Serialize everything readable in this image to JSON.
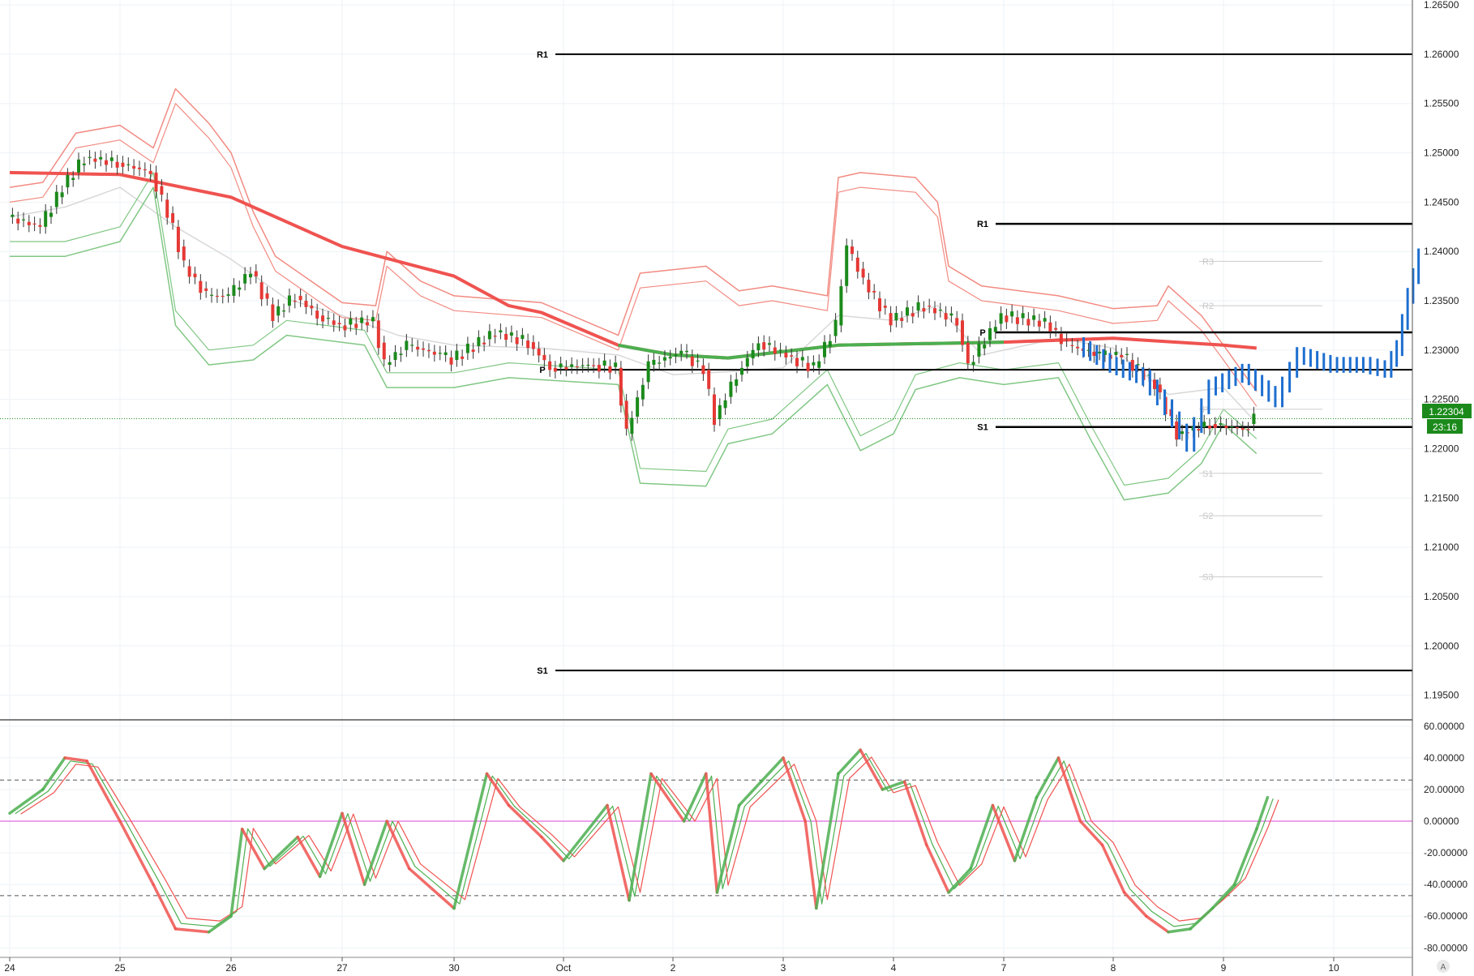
{
  "colors": {
    "bull": "#1b8a1b",
    "bear": "#e53935",
    "forecast": "#1e6fd0",
    "ema_red": "#ef5350",
    "ema_green": "#4caf50",
    "band_red": "#f28b82",
    "band_green": "#81c784",
    "mid_grey": "#d8d8d8",
    "level_line": "#000000",
    "faint_level": "#cccccc",
    "price_tag": "#1b8a1b",
    "osc_fast": "#ef5350",
    "osc_slow": "#4caf50",
    "osc_zero": "#d946d9",
    "grid": "#eef2f6"
  },
  "price_axis": {
    "labels": [
      "1.26500",
      "1.26000",
      "1.25500",
      "1.25000",
      "1.24500",
      "1.24000",
      "1.23500",
      "1.23000",
      "1.22500",
      "1.22000",
      "1.21500",
      "1.21000",
      "1.20500",
      "1.20000",
      "1.19500"
    ],
    "current_price": "1.22304",
    "countdown": "23:16"
  },
  "osc_axis": {
    "labels": [
      "60.00000",
      "40.00000",
      "20.00000",
      "0.00000",
      "-20.00000",
      "-40.00000",
      "-60.00000",
      "-80.00000"
    ]
  },
  "time_axis": {
    "labels": [
      "24",
      "25",
      "26",
      "27",
      "30",
      "Oct",
      "2",
      "3",
      "4",
      "7",
      "8",
      "9",
      "10"
    ],
    "corner": "A"
  },
  "chart_data": {
    "type": "line",
    "title": "",
    "xlabel": "",
    "ylabel": "",
    "ylim": [
      1.1925,
      1.2655
    ],
    "grid": true,
    "pivots": [
      {
        "label": "R1",
        "value": 1.26,
        "x_from": "Oct",
        "x_to": "right-edge"
      },
      {
        "label": "S1",
        "value": 1.1975,
        "x_from": "Oct",
        "x_to": "right-edge"
      },
      {
        "label": "P",
        "value": 1.228,
        "x_from": "Oct",
        "x_to": "right-edge"
      },
      {
        "label": "R1",
        "value": 1.2428,
        "x_from": "7",
        "x_to": "right-edge"
      },
      {
        "label": "P",
        "value": 1.2318,
        "x_from": "7",
        "x_to": "right-edge"
      },
      {
        "label": "S1",
        "value": 1.2222,
        "x_from": "7",
        "x_to": "right-edge"
      }
    ],
    "faint_pivots": [
      {
        "label": "R3",
        "value": 1.239
      },
      {
        "label": "R2",
        "value": 1.2345
      },
      {
        "label": "P",
        "value": 1.224
      },
      {
        "label": "S1",
        "value": 1.2175
      },
      {
        "label": "S2",
        "value": 1.2132
      },
      {
        "label": "S3",
        "value": 1.207
      }
    ],
    "ema_long": [
      {
        "d": 24.0,
        "y": 1.248
      },
      {
        "d": 25.0,
        "y": 1.2478
      },
      {
        "d": 26.0,
        "y": 1.2455
      },
      {
        "d": 27.0,
        "y": 1.2405
      },
      {
        "d": 27.5,
        "y": 1.239
      },
      {
        "d": 30.0,
        "y": 1.2375
      },
      {
        "d": 30.5,
        "y": 1.2345
      },
      {
        "d": 30.8,
        "y": 1.2338
      },
      {
        "d": 31.5,
        "y": 1.2305
      },
      {
        "d": 32.0,
        "y": 1.2295
      },
      {
        "d": 32.5,
        "y": 1.2292
      },
      {
        "d": 33.5,
        "y": 1.2305
      },
      {
        "d": 35.0,
        "y": 1.2308
      },
      {
        "d": 36.0,
        "y": 1.2312
      },
      {
        "d": 37.0,
        "y": 1.2305
      },
      {
        "d": 37.3,
        "y": 1.2302
      }
    ],
    "ema_long_green_ranges": [
      [
        31.5,
        33.5
      ],
      [
        33.5,
        35.7
      ]
    ],
    "band_upper": [
      {
        "d": 24.0,
        "y": 1.2465
      },
      {
        "d": 24.3,
        "y": 1.247
      },
      {
        "d": 24.6,
        "y": 1.252
      },
      {
        "d": 25.0,
        "y": 1.2528
      },
      {
        "d": 25.3,
        "y": 1.2505
      },
      {
        "d": 25.5,
        "y": 1.2565
      },
      {
        "d": 25.8,
        "y": 1.253
      },
      {
        "d": 26.0,
        "y": 1.25
      },
      {
        "d": 26.2,
        "y": 1.244
      },
      {
        "d": 26.4,
        "y": 1.2395
      },
      {
        "d": 27.0,
        "y": 1.2348
      },
      {
        "d": 27.3,
        "y": 1.2345
      },
      {
        "d": 27.4,
        "y": 1.24
      },
      {
        "d": 27.7,
        "y": 1.237
      },
      {
        "d": 30.0,
        "y": 1.2355
      },
      {
        "d": 30.8,
        "y": 1.2348
      },
      {
        "d": 31.5,
        "y": 1.2315
      },
      {
        "d": 31.7,
        "y": 1.2378
      },
      {
        "d": 32.3,
        "y": 1.2385
      },
      {
        "d": 32.6,
        "y": 1.236
      },
      {
        "d": 32.9,
        "y": 1.2365
      },
      {
        "d": 33.4,
        "y": 1.2355
      },
      {
        "d": 33.5,
        "y": 1.2475
      },
      {
        "d": 33.7,
        "y": 1.248
      },
      {
        "d": 34.2,
        "y": 1.2475
      },
      {
        "d": 34.4,
        "y": 1.245
      },
      {
        "d": 34.5,
        "y": 1.2385
      },
      {
        "d": 34.8,
        "y": 1.2365
      },
      {
        "d": 35.5,
        "y": 1.2355
      },
      {
        "d": 36.0,
        "y": 1.2342
      },
      {
        "d": 36.4,
        "y": 1.2345
      },
      {
        "d": 36.5,
        "y": 1.2365
      },
      {
        "d": 36.8,
        "y": 1.2335
      },
      {
        "d": 37.0,
        "y": 1.2305
      },
      {
        "d": 37.3,
        "y": 1.2258
      }
    ],
    "band_lower": [
      {
        "d": 24.0,
        "y": 1.2395
      },
      {
        "d": 24.5,
        "y": 1.2395
      },
      {
        "d": 25.0,
        "y": 1.241
      },
      {
        "d": 25.3,
        "y": 1.2465
      },
      {
        "d": 25.5,
        "y": 1.2325
      },
      {
        "d": 25.8,
        "y": 1.2285
      },
      {
        "d": 26.2,
        "y": 1.229
      },
      {
        "d": 26.5,
        "y": 1.2315
      },
      {
        "d": 27.2,
        "y": 1.2305
      },
      {
        "d": 27.4,
        "y": 1.2262
      },
      {
        "d": 30.0,
        "y": 1.2262
      },
      {
        "d": 30.5,
        "y": 1.2272
      },
      {
        "d": 31.5,
        "y": 1.2265
      },
      {
        "d": 31.7,
        "y": 1.2165
      },
      {
        "d": 32.3,
        "y": 1.2162
      },
      {
        "d": 32.5,
        "y": 1.2205
      },
      {
        "d": 32.9,
        "y": 1.2215
      },
      {
        "d": 33.4,
        "y": 1.2265
      },
      {
        "d": 33.7,
        "y": 1.2198
      },
      {
        "d": 34.0,
        "y": 1.2215
      },
      {
        "d": 34.2,
        "y": 1.226
      },
      {
        "d": 34.6,
        "y": 1.2272
      },
      {
        "d": 35.0,
        "y": 1.2265
      },
      {
        "d": 35.5,
        "y": 1.2272
      },
      {
        "d": 35.8,
        "y": 1.2208
      },
      {
        "d": 36.1,
        "y": 1.2148
      },
      {
        "d": 36.5,
        "y": 1.2155
      },
      {
        "d": 36.8,
        "y": 1.2185
      },
      {
        "d": 37.0,
        "y": 1.2225
      },
      {
        "d": 37.3,
        "y": 1.2195
      }
    ],
    "band_mid": [
      {
        "d": 24.0,
        "y": 1.2435
      },
      {
        "d": 24.5,
        "y": 1.2445
      },
      {
        "d": 25.0,
        "y": 1.2465
      },
      {
        "d": 25.5,
        "y": 1.2425
      },
      {
        "d": 26.0,
        "y": 1.2392
      },
      {
        "d": 26.5,
        "y": 1.2352
      },
      {
        "d": 27.0,
        "y": 1.2335
      },
      {
        "d": 27.5,
        "y": 1.2315
      },
      {
        "d": 30.0,
        "y": 1.2305
      },
      {
        "d": 30.8,
        "y": 1.2302
      },
      {
        "d": 31.5,
        "y": 1.2295
      },
      {
        "d": 32.0,
        "y": 1.2275
      },
      {
        "d": 32.5,
        "y": 1.2278
      },
      {
        "d": 33.0,
        "y": 1.2282
      },
      {
        "d": 33.5,
        "y": 1.2335
      },
      {
        "d": 34.0,
        "y": 1.233
      },
      {
        "d": 34.4,
        "y": 1.2345
      },
      {
        "d": 34.8,
        "y": 1.2295
      },
      {
        "d": 35.5,
        "y": 1.2312
      },
      {
        "d": 36.0,
        "y": 1.2302
      },
      {
        "d": 36.5,
        "y": 1.2255
      },
      {
        "d": 37.0,
        "y": 1.2262
      },
      {
        "d": 37.3,
        "y": 1.2226
      }
    ],
    "forecast": [
      {
        "d": 35.7,
        "y": 1.2305
      },
      {
        "d": 36.0,
        "y": 1.2285
      },
      {
        "d": 36.3,
        "y": 1.2272
      },
      {
        "d": 36.5,
        "y": 1.2242
      },
      {
        "d": 36.7,
        "y": 1.2205
      },
      {
        "d": 36.9,
        "y": 1.2262
      },
      {
        "d": 37.2,
        "y": 1.2278
      },
      {
        "d": 37.5,
        "y": 1.225
      },
      {
        "d": 37.7,
        "y": 1.2295
      },
      {
        "d": 38.0,
        "y": 1.2285
      },
      {
        "d": 38.3,
        "y": 1.2285
      },
      {
        "d": 38.5,
        "y": 1.228
      },
      {
        "d": 38.6,
        "y": 1.2302
      },
      {
        "d": 38.7,
        "y": 1.2355
      },
      {
        "d": 38.8,
        "y": 1.2395
      }
    ],
    "candles": [
      {
        "d": 24.0,
        "y": 1.2435
      },
      {
        "d": 24.3,
        "y": 1.2425
      },
      {
        "d": 24.5,
        "y": 1.2465
      },
      {
        "d": 24.7,
        "y": 1.2495
      },
      {
        "d": 25.0,
        "y": 1.249
      },
      {
        "d": 25.3,
        "y": 1.248
      },
      {
        "d": 25.5,
        "y": 1.2425
      },
      {
        "d": 25.6,
        "y": 1.2385
      },
      {
        "d": 25.8,
        "y": 1.2355
      },
      {
        "d": 26.0,
        "y": 1.2355
      },
      {
        "d": 26.2,
        "y": 1.238
      },
      {
        "d": 26.4,
        "y": 1.2335
      },
      {
        "d": 26.6,
        "y": 1.2355
      },
      {
        "d": 26.8,
        "y": 1.2335
      },
      {
        "d": 27.0,
        "y": 1.2325
      },
      {
        "d": 27.3,
        "y": 1.233
      },
      {
        "d": 27.4,
        "y": 1.2285
      },
      {
        "d": 27.6,
        "y": 1.2305
      },
      {
        "d": 27.9,
        "y": 1.2295
      },
      {
        "d": 30.0,
        "y": 1.229
      },
      {
        "d": 30.4,
        "y": 1.2318
      },
      {
        "d": 30.7,
        "y": 1.2308
      },
      {
        "d": 30.9,
        "y": 1.2282
      },
      {
        "d": 31.3,
        "y": 1.2285
      },
      {
        "d": 31.5,
        "y": 1.2282
      },
      {
        "d": 31.6,
        "y": 1.2215
      },
      {
        "d": 31.8,
        "y": 1.2285
      },
      {
        "d": 32.1,
        "y": 1.2298
      },
      {
        "d": 32.3,
        "y": 1.228
      },
      {
        "d": 32.4,
        "y": 1.223
      },
      {
        "d": 32.6,
        "y": 1.2275
      },
      {
        "d": 32.8,
        "y": 1.2308
      },
      {
        "d": 33.1,
        "y": 1.2292
      },
      {
        "d": 33.3,
        "y": 1.2282
      },
      {
        "d": 33.5,
        "y": 1.2325
      },
      {
        "d": 33.6,
        "y": 1.2405
      },
      {
        "d": 33.8,
        "y": 1.236
      },
      {
        "d": 34.0,
        "y": 1.233
      },
      {
        "d": 34.3,
        "y": 1.2345
      },
      {
        "d": 34.6,
        "y": 1.233
      },
      {
        "d": 34.7,
        "y": 1.2285
      },
      {
        "d": 35.0,
        "y": 1.2335
      },
      {
        "d": 35.4,
        "y": 1.2328
      },
      {
        "d": 35.6,
        "y": 1.2305
      },
      {
        "d": 35.9,
        "y": 1.2295
      },
      {
        "d": 36.1,
        "y": 1.2295
      },
      {
        "d": 36.4,
        "y": 1.2265
      },
      {
        "d": 36.6,
        "y": 1.2215
      },
      {
        "d": 36.9,
        "y": 1.2225
      },
      {
        "d": 37.2,
        "y": 1.222
      },
      {
        "d": 37.3,
        "y": 1.223
      }
    ],
    "oscillator": {
      "ylim": [
        -86,
        64
      ],
      "upper_level": 26,
      "lower_level": -47,
      "zero_level": 0,
      "series": [
        {
          "name": "",
          "values": [
            {
              "d": 24.0,
              "y": 5
            },
            {
              "d": 24.3,
              "y": 20
            },
            {
              "d": 24.5,
              "y": 40
            },
            {
              "d": 24.7,
              "y": 38
            },
            {
              "d": 25.0,
              "y": 0
            },
            {
              "d": 25.3,
              "y": -40
            },
            {
              "d": 25.5,
              "y": -68
            },
            {
              "d": 25.8,
              "y": -70
            },
            {
              "d": 26.0,
              "y": -60
            },
            {
              "d": 26.1,
              "y": -5
            },
            {
              "d": 26.3,
              "y": -30
            },
            {
              "d": 26.6,
              "y": -10
            },
            {
              "d": 26.8,
              "y": -35
            },
            {
              "d": 27.0,
              "y": 5
            },
            {
              "d": 27.2,
              "y": -40
            },
            {
              "d": 27.4,
              "y": 0
            },
            {
              "d": 27.6,
              "y": -30
            },
            {
              "d": 28.0,
              "y": -55
            },
            {
              "d": 30.0,
              "y": -55
            },
            {
              "d": 30.3,
              "y": 30
            },
            {
              "d": 30.5,
              "y": 10
            },
            {
              "d": 30.8,
              "y": -10
            },
            {
              "d": 31.0,
              "y": -25
            },
            {
              "d": 31.4,
              "y": 10
            },
            {
              "d": 31.6,
              "y": -50
            },
            {
              "d": 31.8,
              "y": 30
            },
            {
              "d": 32.1,
              "y": 0
            },
            {
              "d": 32.3,
              "y": 30
            },
            {
              "d": 32.4,
              "y": -45
            },
            {
              "d": 32.6,
              "y": 10
            },
            {
              "d": 32.8,
              "y": 25
            },
            {
              "d": 33.0,
              "y": 40
            },
            {
              "d": 33.2,
              "y": 0
            },
            {
              "d": 33.3,
              "y": -55
            },
            {
              "d": 33.5,
              "y": 30
            },
            {
              "d": 33.7,
              "y": 45
            },
            {
              "d": 33.9,
              "y": 20
            },
            {
              "d": 34.1,
              "y": 25
            },
            {
              "d": 34.3,
              "y": -15
            },
            {
              "d": 34.5,
              "y": -45
            },
            {
              "d": 34.7,
              "y": -30
            },
            {
              "d": 34.9,
              "y": 10
            },
            {
              "d": 35.1,
              "y": -25
            },
            {
              "d": 35.3,
              "y": 15
            },
            {
              "d": 35.5,
              "y": 40
            },
            {
              "d": 35.7,
              "y": 0
            },
            {
              "d": 35.9,
              "y": -15
            },
            {
              "d": 36.1,
              "y": -45
            },
            {
              "d": 36.3,
              "y": -60
            },
            {
              "d": 36.5,
              "y": -70
            },
            {
              "d": 36.7,
              "y": -68
            },
            {
              "d": 36.9,
              "y": -55
            },
            {
              "d": 37.1,
              "y": -40
            },
            {
              "d": 37.3,
              "y": -5
            },
            {
              "d": 37.4,
              "y": 15
            }
          ]
        }
      ]
    }
  }
}
